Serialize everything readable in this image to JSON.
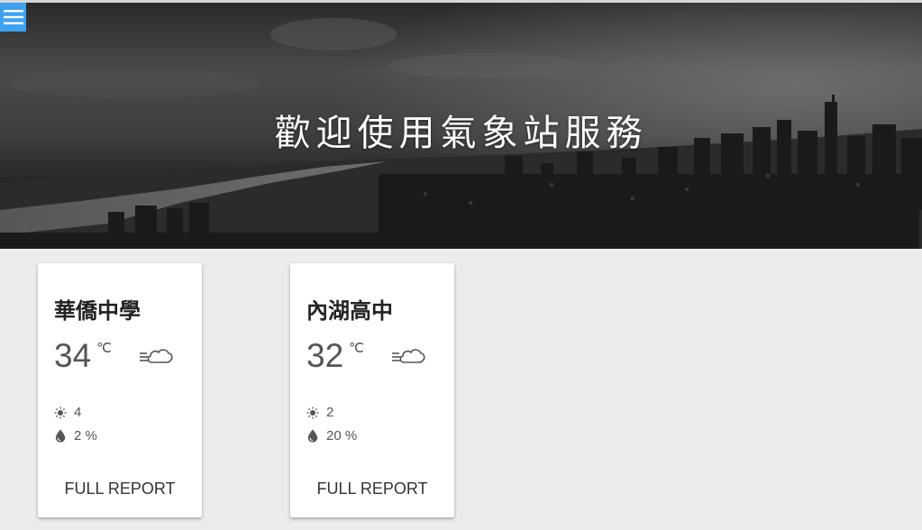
{
  "hero": {
    "title": "歡迎使用氣象站服務"
  },
  "menu": {
    "icon": "hamburger-menu-icon",
    "color": "#3ea2f0"
  },
  "stations": [
    {
      "name": "華僑中學",
      "temperature": "34",
      "unit": "℃",
      "condition_icon": "windy-cloud-icon",
      "uv_icon": "sun-icon",
      "uv": "4",
      "rain_icon": "water-drop-icon",
      "rain": "2 %",
      "report_label": "FULL REPORT"
    },
    {
      "name": "內湖高中",
      "temperature": "32",
      "unit": "℃",
      "condition_icon": "windy-cloud-icon",
      "uv_icon": "sun-icon",
      "uv": "2",
      "rain_icon": "water-drop-icon",
      "rain": "20 %",
      "report_label": "FULL REPORT"
    }
  ]
}
